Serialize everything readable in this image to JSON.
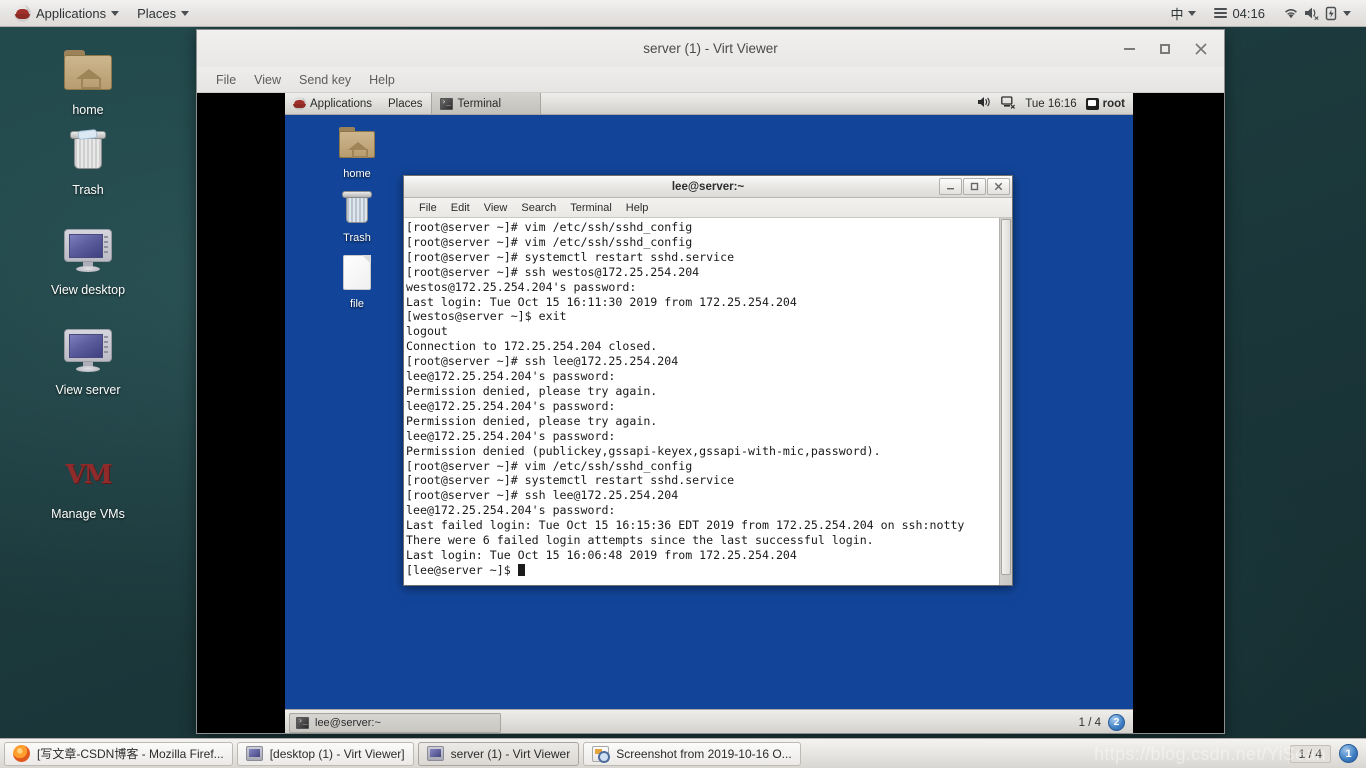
{
  "host": {
    "top_panel": {
      "logo": "redhat-logo",
      "applications_label": "Applications",
      "places_label": "Places",
      "ime_label": "中",
      "clock": "04:16",
      "icons": [
        "wifi-icon",
        "volume-muted-icon",
        "battery-charging-icon",
        "chevron-down-icon"
      ]
    },
    "desktop_icons": [
      {
        "name": "home",
        "label": "home",
        "icon": "folder-home-icon"
      },
      {
        "name": "trash",
        "label": "Trash",
        "icon": "trash-icon"
      },
      {
        "name": "view-desktop",
        "label": "View desktop",
        "icon": "monitor-icon"
      },
      {
        "name": "view-server",
        "label": "View server",
        "icon": "monitor-icon"
      },
      {
        "name": "manage-vms",
        "label": "Manage VMs",
        "icon": "vmm-icon"
      }
    ],
    "taskbar": {
      "buttons": [
        {
          "label": "[写文章-CSDN博客 - Mozilla Firef...",
          "icon": "firefox-icon",
          "active": false
        },
        {
          "label": "[desktop (1) - Virt Viewer]",
          "icon": "virt-viewer-icon",
          "active": false
        },
        {
          "label": "server (1) - Virt Viewer",
          "icon": "virt-viewer-icon",
          "active": true
        },
        {
          "label": "Screenshot from 2019-10-16 O...",
          "icon": "screenshot-icon",
          "active": false
        }
      ],
      "workspace_count": "1 / 4",
      "workspace_badge": "1"
    },
    "watermark": "https://blog.csdn.net/YiSean"
  },
  "virt_viewer": {
    "title": "server (1) - Virt Viewer",
    "menus": [
      "File",
      "View",
      "Send key",
      "Help"
    ],
    "window_controls": [
      "minimize-icon",
      "maximize-icon",
      "close-icon"
    ]
  },
  "guest": {
    "top_panel": {
      "applications_label": "Applications",
      "places_label": "Places",
      "window_task_label": "Terminal",
      "clock": "Tue 16:16",
      "user": "root",
      "tray_icons": [
        "volume-icon",
        "network-disconnected-icon"
      ]
    },
    "desktop_icons": [
      {
        "name": "home",
        "label": "home",
        "icon": "folder-home-icon"
      },
      {
        "name": "trash",
        "label": "Trash",
        "icon": "trash-icon"
      },
      {
        "name": "file",
        "label": "file",
        "icon": "file-icon"
      }
    ],
    "taskbar": {
      "task_label": "lee@server:~",
      "task_icon": "terminal-icon",
      "workspace_count": "1 / 4",
      "workspace_badge": "2"
    }
  },
  "terminal": {
    "title": "lee@server:~",
    "menus": [
      "File",
      "Edit",
      "View",
      "Search",
      "Terminal",
      "Help"
    ],
    "window_controls": [
      "minimize-icon",
      "maximize-icon",
      "close-icon"
    ],
    "lines": [
      "[root@server ~]# vim /etc/ssh/sshd_config",
      "[root@server ~]# vim /etc/ssh/sshd_config",
      "[root@server ~]# systemctl restart sshd.service",
      "[root@server ~]# ssh westos@172.25.254.204",
      "westos@172.25.254.204's password:",
      "Last login: Tue Oct 15 16:11:30 2019 from 172.25.254.204",
      "[westos@server ~]$ exit",
      "logout",
      "Connection to 172.25.254.204 closed.",
      "[root@server ~]# ssh lee@172.25.254.204",
      "lee@172.25.254.204's password:",
      "Permission denied, please try again.",
      "lee@172.25.254.204's password:",
      "Permission denied, please try again.",
      "lee@172.25.254.204's password:",
      "Permission denied (publickey,gssapi-keyex,gssapi-with-mic,password).",
      "[root@server ~]# vim /etc/ssh/sshd_config",
      "[root@server ~]# systemctl restart sshd.service",
      "[root@server ~]# ssh lee@172.25.254.204",
      "lee@172.25.254.204's password:",
      "Last failed login: Tue Oct 15 16:15:36 EDT 2019 from 172.25.254.204 on ssh:notty",
      "There were 6 failed login attempts since the last successful login.",
      "Last login: Tue Oct 15 16:06:48 2019 from 172.25.254.204",
      "[lee@server ~]$ "
    ]
  },
  "colors": {
    "host_desktop": "#1d3a3d",
    "guest_desktop": "#12459a",
    "panel_bg": "#e7e5e3",
    "terminal_bg": "#ffffff",
    "terminal_fg": "#1a1a1a",
    "accent_blue": "#3a7bc0"
  }
}
